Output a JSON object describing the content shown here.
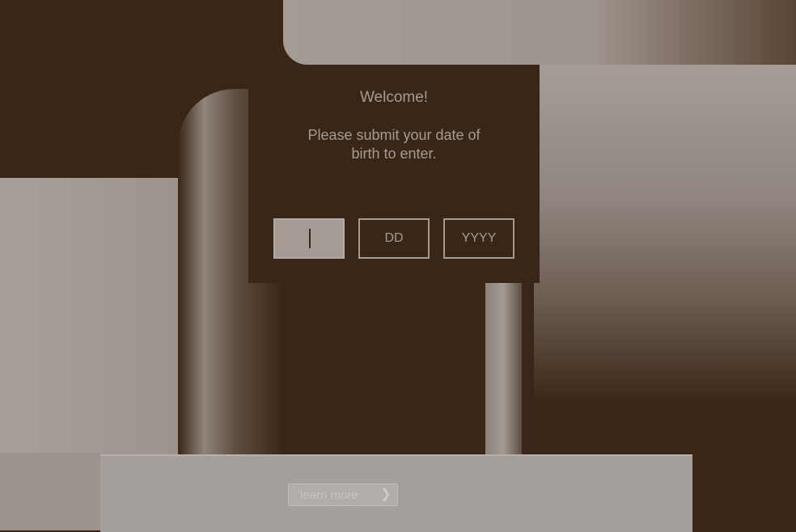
{
  "age_gate": {
    "welcome": "Welcome!",
    "message": "Please submit your date of birth to enter.",
    "month_placeholder": "",
    "day_placeholder": "DD",
    "year_placeholder": "YYYY"
  },
  "banner": {
    "learn_more_label": "learn more"
  },
  "icons": {
    "learn_more_arrow": "chevron-right-icon"
  },
  "colors": {
    "modal_bg": "#3a2616",
    "text": "#a49b95",
    "banner_bg": "#a59f9b"
  }
}
